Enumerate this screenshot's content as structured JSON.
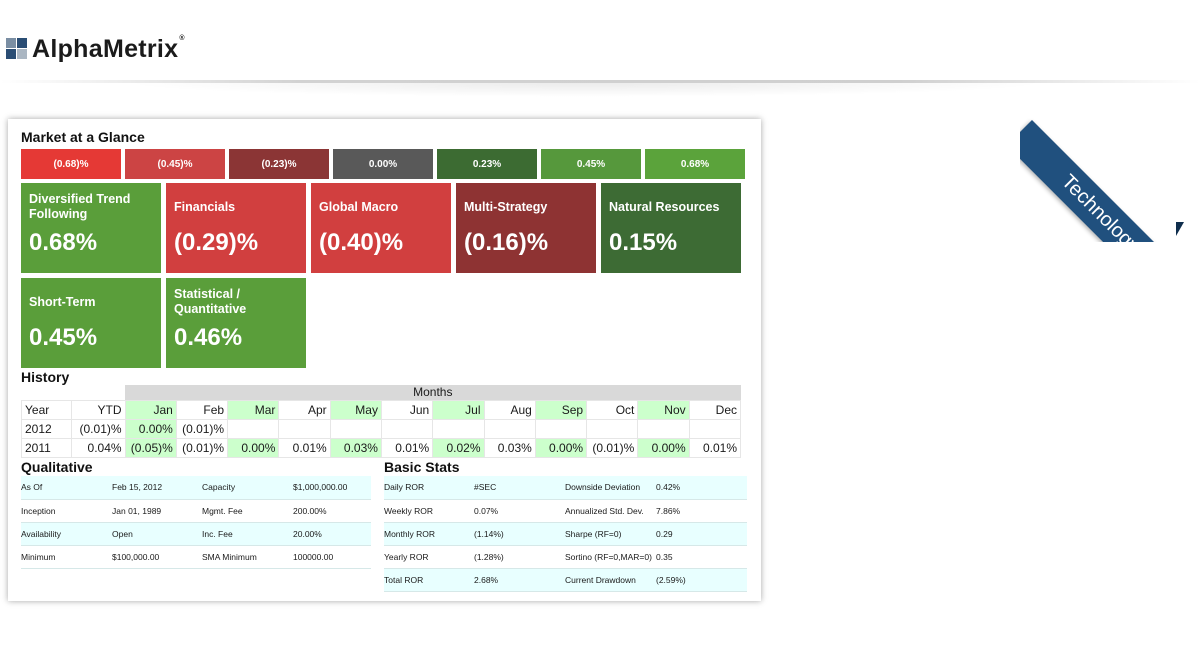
{
  "header": {
    "brand": "AlphaMetrix",
    "trademark": "®"
  },
  "ribbon": {
    "label": "Technology"
  },
  "market": {
    "title": "Market at a Glance",
    "strip": [
      {
        "label": "(0.68)%",
        "color": "#e53935"
      },
      {
        "label": "(0.45)%",
        "color": "#cc4444"
      },
      {
        "label": "(0.23)%",
        "color": "#8b3535"
      },
      {
        "label": "0.00%",
        "color": "#595959"
      },
      {
        "label": "0.23%",
        "color": "#3c6b32"
      },
      {
        "label": "0.45%",
        "color": "#56983c"
      },
      {
        "label": "0.68%",
        "color": "#5ba33b"
      }
    ],
    "tiles": [
      {
        "name": "Diversified Trend Following",
        "value": "0.68%",
        "color": "#5a9e3a"
      },
      {
        "name": "Financials",
        "value": "(0.29)%",
        "color": "#d13f3f"
      },
      {
        "name": "Global Macro",
        "value": "(0.40)%",
        "color": "#d13f3f"
      },
      {
        "name": "Multi-Strategy",
        "value": "(0.16)%",
        "color": "#8e3333"
      },
      {
        "name": "Natural Resources",
        "value": "0.15%",
        "color": "#3d6b34"
      },
      {
        "name": "Short-Term",
        "value": "0.45%",
        "color": "#5a9e3a"
      },
      {
        "name": "Statistical / Quantitative",
        "value": "0.46%",
        "color": "#5a9e3a"
      }
    ]
  },
  "history": {
    "title": "History",
    "months_label": "Months",
    "columns": [
      "Year",
      "YTD",
      "Jan",
      "Feb",
      "Mar",
      "Apr",
      "May",
      "Jun",
      "Jul",
      "Aug",
      "Sep",
      "Oct",
      "Nov",
      "Dec"
    ],
    "rows": [
      [
        "2012",
        "(0.01)%",
        "0.00%",
        "(0.01)%",
        "",
        "",
        "",
        "",
        "",
        "",
        "",
        "",
        "",
        ""
      ],
      [
        "2011",
        "0.04%",
        "(0.05)%",
        "(0.01)%",
        "0.00%",
        "0.01%",
        "0.03%",
        "0.01%",
        "0.02%",
        "0.03%",
        "0.00%",
        "(0.01)%",
        "0.00%",
        "0.01%"
      ]
    ]
  },
  "qualitative": {
    "title": "Qualitative",
    "rows": [
      [
        "As Of",
        "Feb 15, 2012",
        "Capacity",
        "$1,000,000.00"
      ],
      [
        "Inception",
        "Jan 01, 1989",
        "Mgmt. Fee",
        "200.00%"
      ],
      [
        "Availability",
        "Open",
        "Inc. Fee",
        "20.00%"
      ],
      [
        "Minimum",
        "$100,000.00",
        "SMA Minimum",
        "100000.00"
      ]
    ]
  },
  "basic_stats": {
    "title": "Basic Stats",
    "rows": [
      [
        "Daily ROR",
        "#SEC",
        "Downside Deviation",
        "0.42%"
      ],
      [
        "Weekly ROR",
        "0.07%",
        "Annualized Std. Dev.",
        "7.86%"
      ],
      [
        "Monthly ROR",
        "(1.14%)",
        "Sharpe (RF=0)",
        "0.29"
      ],
      [
        "Yearly ROR",
        "(1.28%)",
        "Sortino (RF=0,MAR=0)",
        "0.35"
      ],
      [
        "Total ROR",
        "2.68%",
        "Current Drawdown",
        "(2.59%)"
      ]
    ]
  }
}
